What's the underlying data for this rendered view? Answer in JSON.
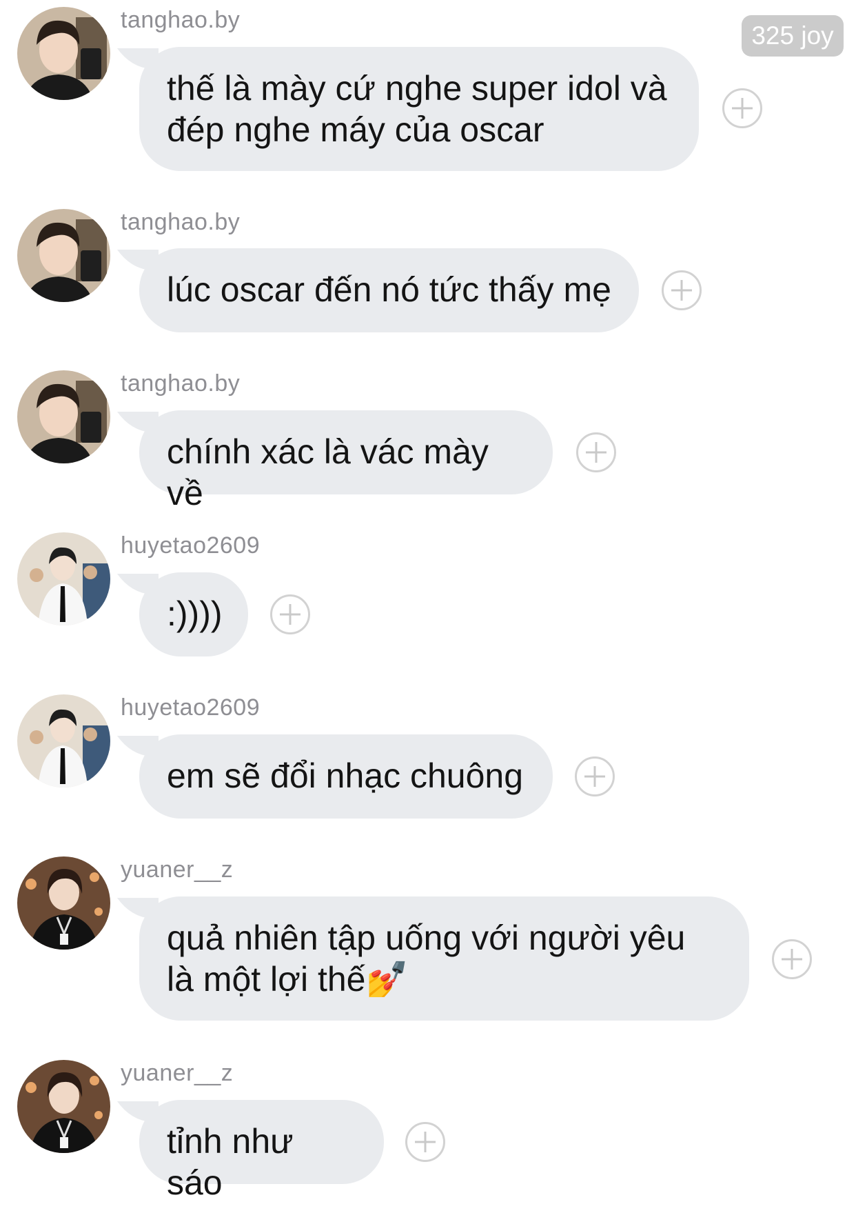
{
  "header": {
    "badge_text": "325 joy"
  },
  "messages": [
    {
      "username": "tanghao.by",
      "text": "thế là mày cứ nghe super idol và đép nghe máy của oscar",
      "avatar": "avatar-tanghao-icon"
    },
    {
      "username": "tanghao.by",
      "text": "lúc oscar đến nó tức thấy mẹ",
      "avatar": "avatar-tanghao-icon"
    },
    {
      "username": "tanghao.by",
      "text": "chính xác là vác mày về",
      "avatar": "avatar-tanghao-icon"
    },
    {
      "username": "huyetao2609",
      "text": ":))))",
      "avatar": "avatar-huyetao-icon"
    },
    {
      "username": "huyetao2609",
      "text": "em sẽ đổi nhạc chuông",
      "avatar": "avatar-huyetao-icon"
    },
    {
      "username": "yuaner__z",
      "text": "quả nhiên tập uống với người yêu là một lợi thế💅",
      "avatar": "avatar-yuaner-icon"
    },
    {
      "username": "yuaner__z",
      "text": "tỉnh như sáo",
      "avatar": "avatar-yuaner-icon"
    }
  ],
  "colors": {
    "bubble": "#e9ebee",
    "username": "#8e8e93",
    "badge": "#cbcbcb",
    "plus_icon": "#d2d2d2"
  }
}
